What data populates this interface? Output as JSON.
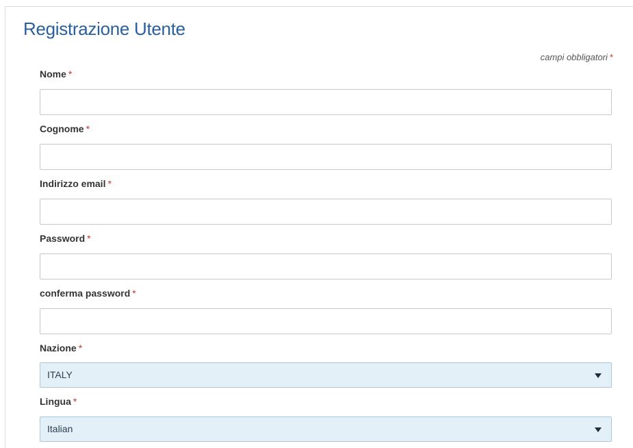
{
  "form": {
    "title": "Registrazione Utente",
    "required_note": "campi obbligatori",
    "required_marker": "*"
  },
  "fields": {
    "nome": {
      "label": "Nome",
      "value": ""
    },
    "cognome": {
      "label": "Cognome",
      "value": ""
    },
    "email": {
      "label": "Indirizzo email",
      "value": ""
    },
    "password": {
      "label": "Password",
      "value": ""
    },
    "confirm_password": {
      "label": "conferma password",
      "value": ""
    },
    "nazione": {
      "label": "Nazione",
      "selected": "ITALY"
    },
    "lingua": {
      "label": "Lingua",
      "selected": "Italian"
    }
  },
  "colors": {
    "title": "#2a5f9e",
    "required_star": "#c0392b",
    "select_background": "#e3f0f8",
    "select_border": "#a9c7dc"
  }
}
